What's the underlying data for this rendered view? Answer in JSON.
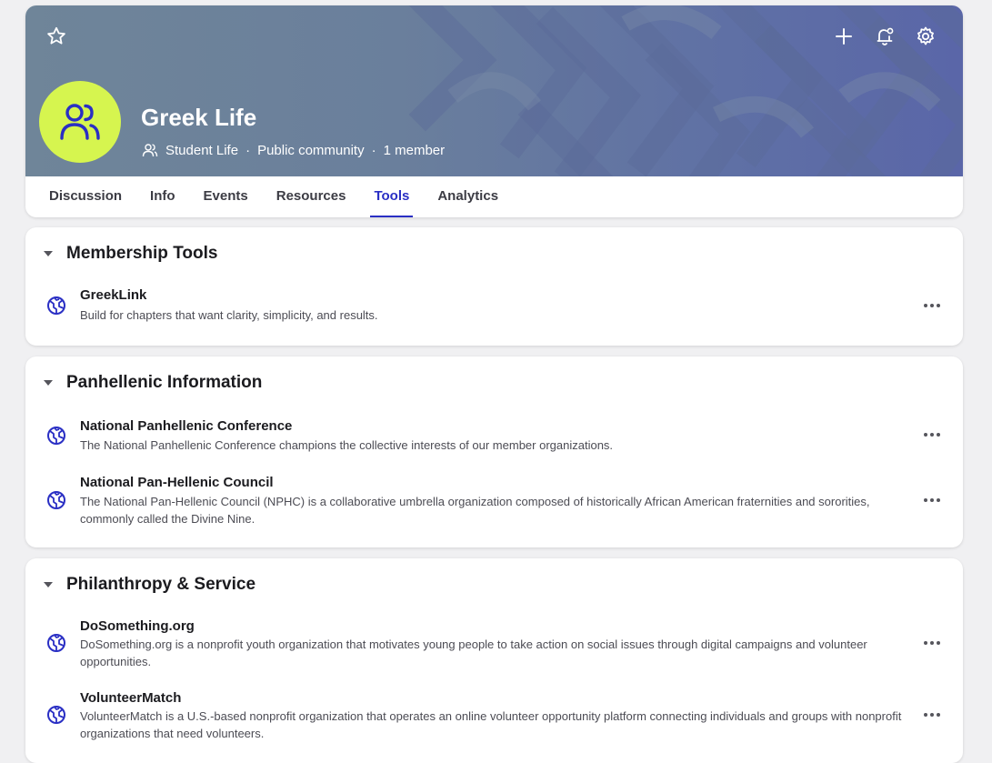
{
  "group": {
    "name": "Greek Life",
    "category": "Student Life",
    "visibility": "Public community",
    "members": "1 member",
    "separator": "·"
  },
  "tabs": [
    {
      "label": "Discussion"
    },
    {
      "label": "Info"
    },
    {
      "label": "Events"
    },
    {
      "label": "Resources"
    },
    {
      "label": "Tools",
      "active": true
    },
    {
      "label": "Analytics"
    }
  ],
  "sections": [
    {
      "title": "Membership Tools",
      "items": [
        {
          "name": "GreekLink",
          "description": "Build for chapters that want clarity, simplicity, and results."
        }
      ]
    },
    {
      "title": "Panhellenic Information",
      "items": [
        {
          "name": "National Panhellenic Conference",
          "description": "The National Panhellenic Conference champions the collective interests of our member organizations."
        },
        {
          "name": "National Pan-Hellenic Council",
          "description": "The National Pan-Hellenic Council (NPHC) is a collaborative umbrella organization composed of historically African American fraternities and sororities, commonly called the Divine Nine."
        }
      ]
    },
    {
      "title": "Philanthropy & Service",
      "items": [
        {
          "name": "DoSomething.org",
          "description": "DoSomething.org is a nonprofit youth organization that motivates young people to take action on social issues through digital campaigns and volunteer opportunities."
        },
        {
          "name": "VolunteerMatch",
          "description": "VolunteerMatch is a U.S.-based nonprofit organization that operates an online volunteer opportunity platform connecting individuals and groups with nonprofit organizations that need volunteers."
        }
      ]
    }
  ],
  "icons": {
    "favorite": "star-icon",
    "add": "plus-icon",
    "notifications": "bell-settings-icon",
    "settings": "gear-icon",
    "avatar": "people-icon",
    "item": "globe-icon",
    "item_menu": "more-horizontal-icon"
  },
  "colors": {
    "accent": "#2a2fc4",
    "avatar_bg": "#d6f54f",
    "banner_left": "#6f8599",
    "banner_right": "#5a66a8"
  }
}
